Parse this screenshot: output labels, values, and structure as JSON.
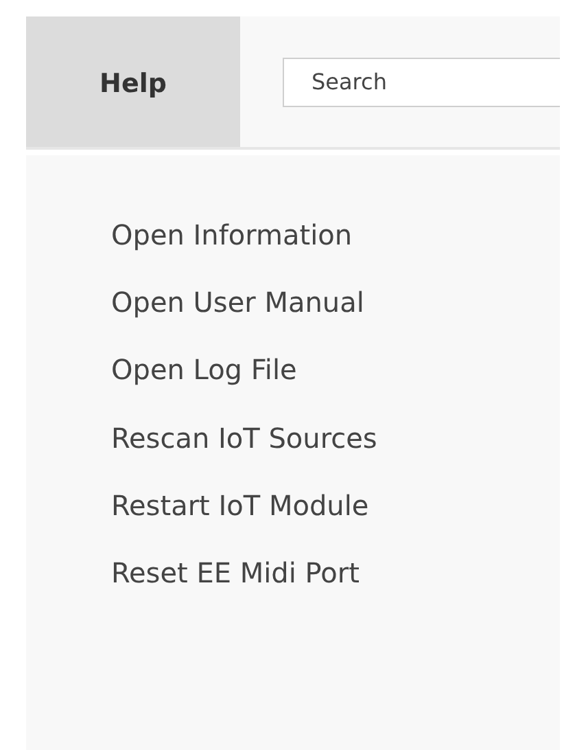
{
  "header": {
    "tab": {
      "label": "Help",
      "selected": true
    },
    "search": {
      "placeholder": "Search"
    }
  },
  "menu": {
    "items": [
      {
        "label": "Open Information"
      },
      {
        "label": "Open User Manual"
      },
      {
        "label": "Open Log File"
      },
      {
        "label": "Rescan IoT Sources"
      },
      {
        "label": "Restart IoT Module"
      },
      {
        "label": "Reset EE Midi Port"
      }
    ]
  }
}
